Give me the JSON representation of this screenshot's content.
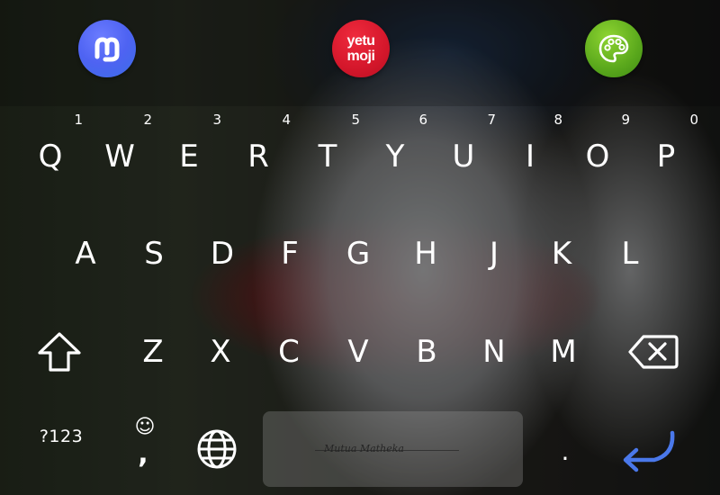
{
  "apps": {
    "left": {
      "icon": "mastodon-m-icon",
      "color": "#4e63f2"
    },
    "center": {
      "line1": "yetu",
      "line2": "moji",
      "color": "#d4172b"
    },
    "right": {
      "icon": "palette-icon",
      "color": "#5aa81c"
    }
  },
  "row1": [
    {
      "letter": "Q",
      "hint": "1"
    },
    {
      "letter": "W",
      "hint": "2"
    },
    {
      "letter": "E",
      "hint": "3"
    },
    {
      "letter": "R",
      "hint": "4"
    },
    {
      "letter": "T",
      "hint": "5"
    },
    {
      "letter": "Y",
      "hint": "6"
    },
    {
      "letter": "U",
      "hint": "7"
    },
    {
      "letter": "I",
      "hint": "8"
    },
    {
      "letter": "O",
      "hint": "9"
    },
    {
      "letter": "P",
      "hint": "0"
    }
  ],
  "row2": [
    "A",
    "S",
    "D",
    "F",
    "G",
    "H",
    "J",
    "K",
    "L"
  ],
  "row3": [
    "Z",
    "X",
    "C",
    "V",
    "B",
    "N",
    "M"
  ],
  "bottom": {
    "symbols_label": "?123",
    "smiley": "☺",
    "comma": ",",
    "space_watermark": "Mutua Matheka",
    "period": ".",
    "enter_color": "#3f6fe0"
  }
}
